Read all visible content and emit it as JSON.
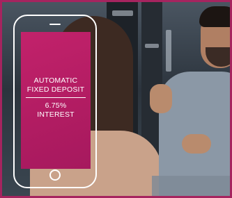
{
  "ad": {
    "line1": "AUTOMATIC",
    "line2": "FIXED DEPOSIT",
    "line3": "6.75%",
    "line4": "INTEREST"
  },
  "colors": {
    "border": "#a6245f",
    "screen": "#b81e66",
    "text": "#ffffff"
  },
  "icons": [
    "smartphone-outline-icon",
    "home-button-icon",
    "earpiece-icon"
  ]
}
